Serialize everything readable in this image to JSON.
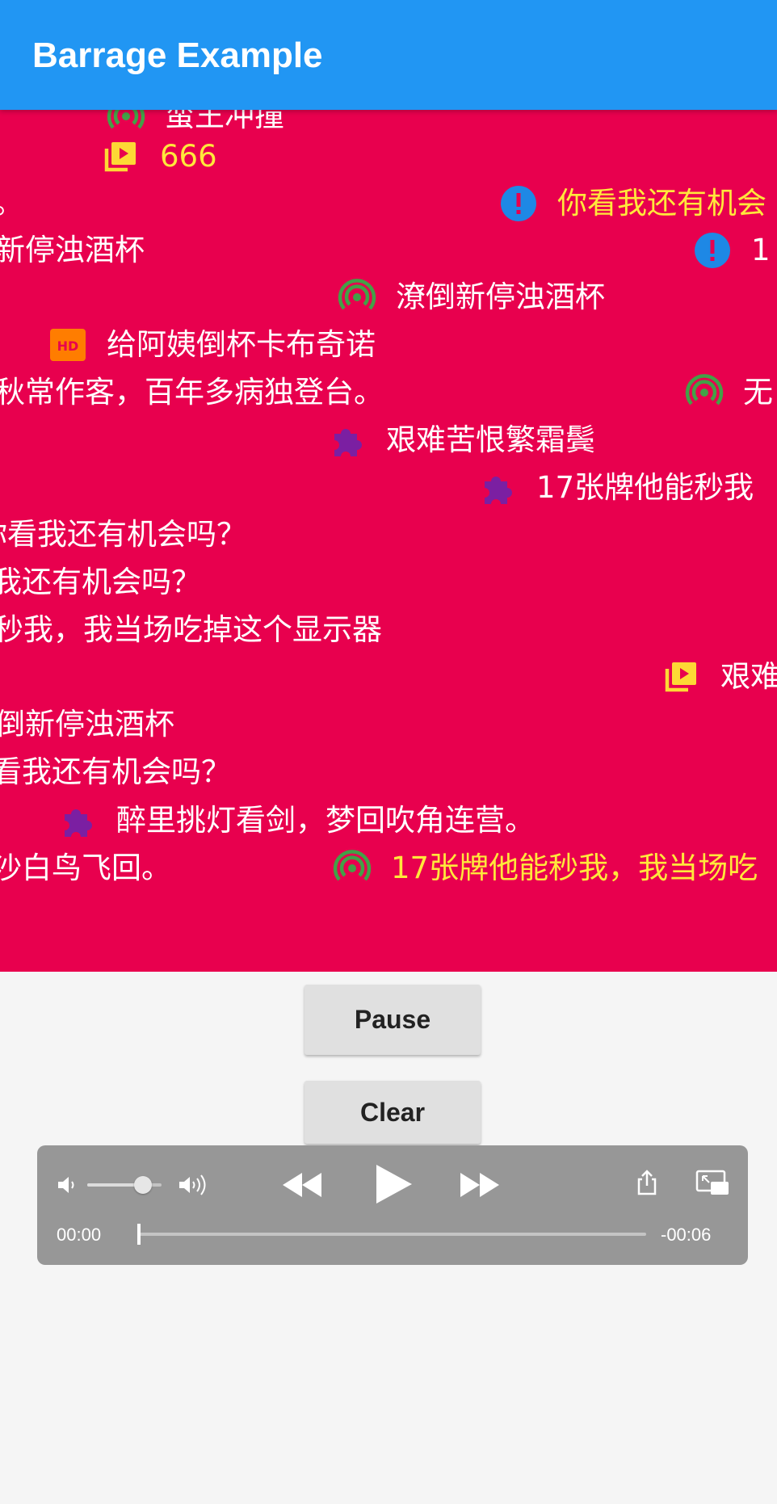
{
  "app": {
    "title": "Barrage Example"
  },
  "barrage": {
    "background": "#e8004e",
    "items": [
      {
        "text": "蛮王冲撞",
        "icon": "radio-waves-icon",
        "color": "white"
      },
      {
        "text": "666",
        "icon": "video-library-icon",
        "color": "yellow"
      },
      {
        "text": "。",
        "icon": "",
        "color": "white"
      },
      {
        "text": "你看我还有机会",
        "icon": "alert-circle-icon",
        "color": "yellow"
      },
      {
        "text": "新停浊酒杯",
        "icon": "",
        "color": "white"
      },
      {
        "text": "1",
        "icon": "alert-circle-icon",
        "color": "white"
      },
      {
        "text": "潦倒新停浊酒杯",
        "icon": "radio-waves-icon",
        "color": "white"
      },
      {
        "text": "给阿姨倒杯卡布奇诺",
        "icon": "hd-badge-icon",
        "color": "white"
      },
      {
        "text": "秋常作客，百年多病独登台。",
        "icon": "",
        "color": "white"
      },
      {
        "text": "无",
        "icon": "radio-waves-icon",
        "color": "white"
      },
      {
        "text": "艰难苦恨繁霜鬓",
        "icon": "puzzle-piece-icon",
        "color": "white"
      },
      {
        "text": "17张牌他能秒我",
        "icon": "puzzle-piece-icon",
        "color": "white"
      },
      {
        "text": "你看我还有机会吗？",
        "icon": "",
        "color": "white"
      },
      {
        "text": "我还有机会吗？",
        "icon": "",
        "color": "white"
      },
      {
        "text": "秒我，我当场吃掉这个显示器",
        "icon": "",
        "color": "white"
      },
      {
        "text": "艰难",
        "icon": "video-library-icon",
        "color": "white"
      },
      {
        "text": "倒新停浊酒杯",
        "icon": "",
        "color": "white"
      },
      {
        "text": "看我还有机会吗？",
        "icon": "",
        "color": "white"
      },
      {
        "text": "醉里挑灯看剑，梦回吹角连营。",
        "icon": "puzzle-piece-icon",
        "color": "white"
      },
      {
        "text": "沙白鸟飞回。",
        "icon": "",
        "color": "white"
      },
      {
        "text": "17张牌他能秒我，我当场吃",
        "icon": "radio-waves-icon",
        "color": "yellow"
      }
    ]
  },
  "controls": {
    "pause_label": "Pause",
    "clear_label": "Clear"
  },
  "player": {
    "current_time": "00:00",
    "remaining_time": "-00:06",
    "volume_level": 0.75,
    "progress": 0.0
  }
}
